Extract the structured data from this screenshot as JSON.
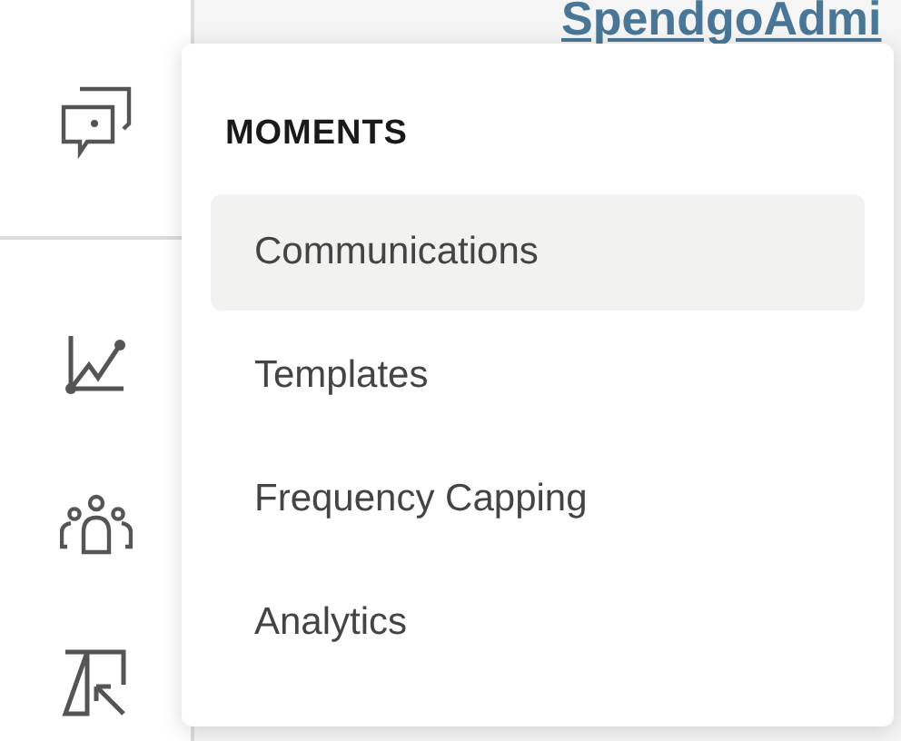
{
  "header_link": "SpendgoAdmi",
  "menu": {
    "title": "MOMENTS",
    "items": [
      {
        "label": "Communications",
        "selected": true
      },
      {
        "label": "Templates",
        "selected": false
      },
      {
        "label": "Frequency Capping",
        "selected": false
      },
      {
        "label": "Analytics",
        "selected": false
      }
    ]
  }
}
